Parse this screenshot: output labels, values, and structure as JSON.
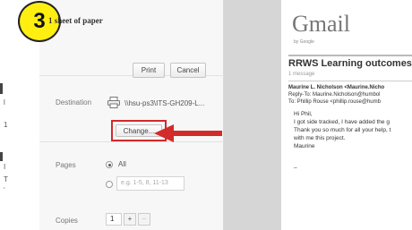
{
  "step": {
    "number": "3"
  },
  "left_strip": {
    "fragments": [
      "I",
      "l",
      "1",
      "I",
      "T",
      "‘"
    ]
  },
  "print_panel": {
    "summary": "1 sheet of paper",
    "print_button": "Print",
    "cancel_button": "Cancel",
    "destination": {
      "label": "Destination",
      "printer_name": "\\\\hsu-ps3\\ITS-GH209-L...",
      "change_button": "Change..."
    },
    "pages": {
      "label": "Pages",
      "all_option": "All",
      "range_placeholder": "e.g. 1-5, 8, 11-13"
    },
    "copies": {
      "label": "Copies",
      "value": "1",
      "plus": "+",
      "minus": "−"
    }
  },
  "email_preview": {
    "logo": "Gmail",
    "logo_sub": "by Google",
    "subject": "RRWS Learning outcomes",
    "message_count": "1 message",
    "from": "Maurine L. Nicholson <Maurine.Nicho",
    "reply_to": "Reply-To: Maurine.Nicholson@humbol",
    "to": "To: Phillip Rouse <phillip.rouse@humb",
    "body": [
      "Hi Phil,",
      "I got side tracked, I have added the g",
      "Thank you so much for all your help, t",
      "with me this project.",
      "Maurine"
    ],
    "signature": "–"
  },
  "colors": {
    "badge": "#ffef10",
    "highlight": "#d32a2a",
    "arrow": "#d32a2a"
  }
}
